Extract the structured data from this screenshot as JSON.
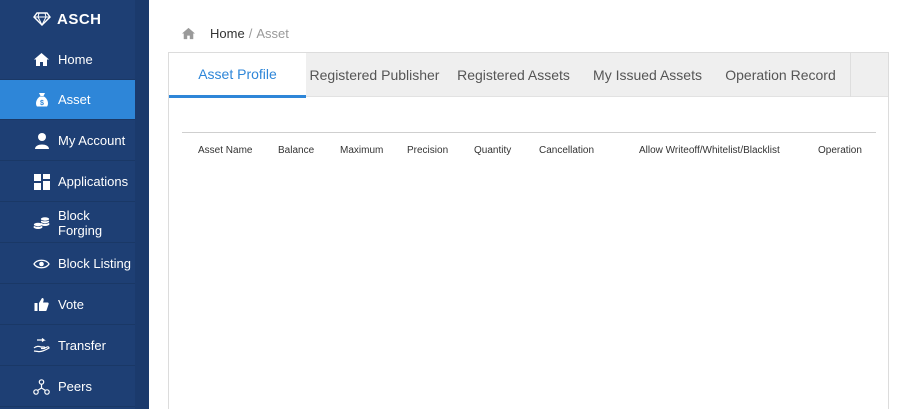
{
  "brand": {
    "name": "ASCH"
  },
  "sidebar": {
    "items": [
      {
        "label": "Home",
        "icon": "home-icon"
      },
      {
        "label": "Asset",
        "icon": "money-bag-icon",
        "active": true
      },
      {
        "label": "My Account",
        "icon": "user-icon"
      },
      {
        "label": "Applications",
        "icon": "apps-grid-icon"
      },
      {
        "label": "Block Forging",
        "icon": "coins-icon"
      },
      {
        "label": "Block Listing",
        "icon": "eye-icon"
      },
      {
        "label": "Vote",
        "icon": "thumbs-up-icon"
      },
      {
        "label": "Transfer",
        "icon": "transfer-hand-icon"
      },
      {
        "label": "Peers",
        "icon": "peers-network-icon"
      }
    ]
  },
  "breadcrumb": {
    "home": "Home",
    "separator": "/",
    "current": "Asset"
  },
  "tabs": [
    {
      "label": "Asset Profile",
      "active": true
    },
    {
      "label": "Registered Publisher"
    },
    {
      "label": "Registered Assets"
    },
    {
      "label": "My Issued Assets"
    },
    {
      "label": "Operation Record"
    }
  ],
  "table": {
    "columns": [
      "Asset Name",
      "Balance",
      "Maximum",
      "Precision",
      "Quantity",
      "Cancellation",
      "Allow Writeoff/Whitelist/Blacklist",
      "Operation"
    ],
    "rows": []
  },
  "colors": {
    "sidebar_bg": "#1e3f74",
    "active_item": "#2e86d8",
    "accent": "#2e86d8"
  }
}
